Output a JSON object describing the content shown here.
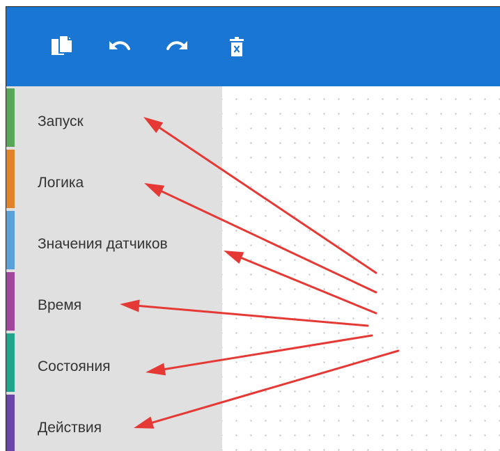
{
  "toolbar": {
    "buttons": [
      {
        "name": "copy-button",
        "icon": "copy-icon"
      },
      {
        "name": "undo-button",
        "icon": "undo-icon"
      },
      {
        "name": "redo-button",
        "icon": "redo-icon"
      },
      {
        "name": "delete-button",
        "icon": "trash-icon"
      }
    ],
    "background": "#1976d2"
  },
  "sidebar": {
    "categories": [
      {
        "label": "Запуск",
        "color": "#5ba55b"
      },
      {
        "label": "Логика",
        "color": "#e0832b"
      },
      {
        "label": "Значения датчиков",
        "color": "#5ba0d9"
      },
      {
        "label": "Время",
        "color": "#a1479e"
      },
      {
        "label": "Состояния",
        "color": "#21a38c"
      },
      {
        "label": "Действия",
        "color": "#6a45a8"
      }
    ]
  },
  "annotations": {
    "arrow_color": "#e53935"
  }
}
